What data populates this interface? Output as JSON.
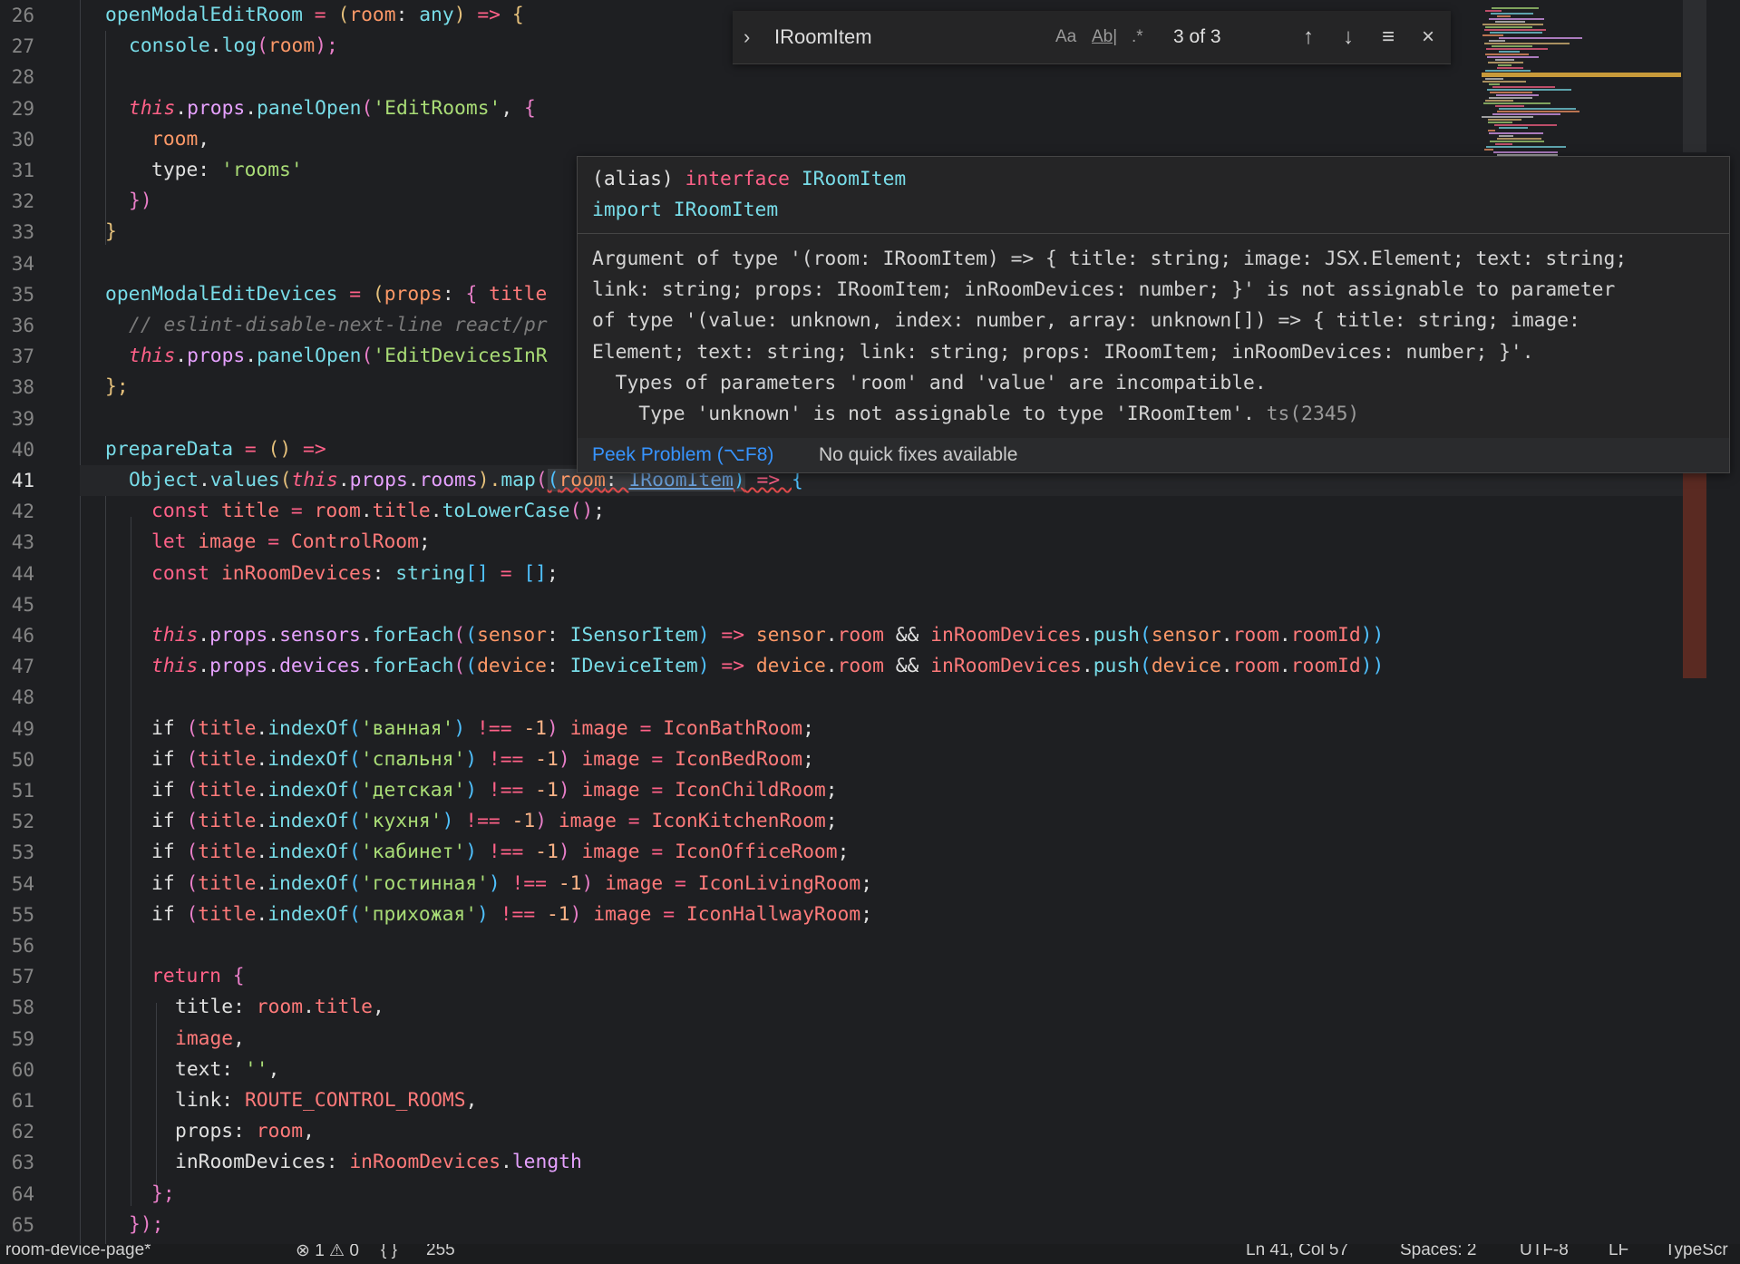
{
  "find_widget": {
    "query": "IRoomItem",
    "match_case_label": "Aa",
    "whole_word_label": "Ab|",
    "regex_label": ".*",
    "match_count": "3 of 3"
  },
  "hover": {
    "line1_alias": "(alias)",
    "line1_kw": "interface",
    "line1_name": "IRoomItem",
    "line2_kw": "import",
    "line2_name": "IRoomItem",
    "error_lines": [
      "Argument of type '(room: IRoomItem) => { title: string; image: JSX.Element; text: string;",
      "link: string; props: IRoomItem; inRoomDevices: number; }' is not assignable to parameter",
      "of type '(value: unknown, index: number, array: unknown[]) => { title: string; image:",
      "Element; text: string; link: string; props: IRoomItem; inRoomDevices: number; }'.",
      "  Types of parameters 'room' and 'value' are incompatible.",
      "    Type 'unknown' is not assignable to type 'IRoomItem'."
    ],
    "error_code": "ts(2345)",
    "peek_label": "Peek Problem (⌥F8)",
    "no_fix_label": "No quick fixes available"
  },
  "line_numbers": [
    "26",
    "27",
    "28",
    "29",
    "30",
    "31",
    "32",
    "33",
    "34",
    "35",
    "36",
    "37",
    "38",
    "39",
    "40",
    "41",
    "42",
    "43",
    "44",
    "45",
    "46",
    "47",
    "48",
    "49",
    "50",
    "51",
    "52",
    "53",
    "54",
    "55",
    "56",
    "57",
    "58",
    "59",
    "60",
    "61",
    "62",
    "63",
    "64",
    "65"
  ],
  "active_line": "41",
  "code": {
    "l26": [
      "openModalEditRoom",
      " = ",
      "(",
      "room",
      ": ",
      "any",
      ")",
      " => ",
      "{"
    ],
    "l27": [
      "console",
      ".",
      "log",
      "(",
      "room",
      ");"
    ],
    "l29": [
      "this",
      ".",
      "props",
      ".",
      "panelOpen",
      "(",
      "'EditRooms'",
      ", ",
      "{"
    ],
    "l30": [
      "room",
      ","
    ],
    "l31": [
      "type",
      ": ",
      "'rooms'"
    ],
    "l32": [
      "})"
    ],
    "l33": [
      "}"
    ],
    "l35": [
      "openModalEditDevices",
      " = ",
      "(",
      "props",
      ": ",
      "{ ",
      "title"
    ],
    "l36": [
      "// eslint-disable-next-line react/pr"
    ],
    "l37": [
      "this",
      ".",
      "props",
      ".",
      "panelOpen",
      "(",
      "'EditDevicesInR"
    ],
    "l38": [
      "};"
    ],
    "l40": [
      "prepareData",
      " = ",
      "()",
      " =>"
    ],
    "l41": [
      "Object",
      ".",
      "values",
      "(",
      "this",
      ".",
      "props",
      ".",
      "rooms",
      ").",
      "map",
      "(",
      "(",
      "room",
      ": ",
      "IRoomItem",
      ")",
      " => ",
      "{"
    ],
    "l42": [
      "const ",
      "title",
      " = ",
      "room",
      ".",
      "title",
      ".",
      "toLowerCase",
      "()",
      ";"
    ],
    "l43": [
      "let ",
      "image",
      " = ",
      "ControlRoom",
      ";"
    ],
    "l44": [
      "const ",
      "inRoomDevices",
      ": ",
      "string",
      "[]",
      " = ",
      "[]",
      ";"
    ],
    "l46": [
      "this",
      ".",
      "props",
      ".",
      "sensors",
      ".",
      "forEach",
      "(",
      "(",
      "sensor",
      ": ",
      "ISensorItem",
      ")",
      " => ",
      "sensor",
      ".",
      "room",
      " && ",
      "inRoomDevices",
      ".",
      "push",
      "(",
      "sensor",
      ".",
      "room",
      ".",
      "roomId",
      "))"
    ],
    "l47": [
      "this",
      ".",
      "props",
      ".",
      "devices",
      ".",
      "forEach",
      "(",
      "(",
      "device",
      ": ",
      "IDeviceItem",
      ")",
      " => ",
      "device",
      ".",
      "room",
      " && ",
      "inRoomDevices",
      ".",
      "push",
      "(",
      "device",
      ".",
      "room",
      ".",
      "roomId",
      "))"
    ],
    "conds": [
      {
        "str": "'ванная'",
        "icon": "IconBathRoom"
      },
      {
        "str": "'спальня'",
        "icon": "IconBedRoom"
      },
      {
        "str": "'детская'",
        "icon": "IconChildRoom"
      },
      {
        "str": "'кухня'",
        "icon": "IconKitchenRoom"
      },
      {
        "str": "'кабинет'",
        "icon": "IconOfficeRoom"
      },
      {
        "str": "'гостинная'",
        "icon": "IconLivingRoom"
      },
      {
        "str": "'прихожая'",
        "icon": "IconHallwayRoom"
      }
    ],
    "cond_parts": [
      "if ",
      "(",
      "title",
      ".",
      "indexOf",
      "(",
      ")",
      " !== ",
      "-1",
      ")",
      " image",
      " = ",
      ";"
    ],
    "l57": [
      "return ",
      "{"
    ],
    "l58": [
      "title",
      ": ",
      "room",
      ".",
      "title",
      ","
    ],
    "l59": [
      "image",
      ","
    ],
    "l60": [
      "text",
      ": ",
      "''",
      ","
    ],
    "l61": [
      "link",
      ": ",
      "ROUTE_CONTROL_ROOMS",
      ","
    ],
    "l62": [
      "props",
      ": ",
      "room",
      ","
    ],
    "l63": [
      "inRoomDevices",
      ": ",
      "inRoomDevices",
      ".",
      "length"
    ],
    "l64": [
      "};"
    ],
    "l65": [
      "});"
    ]
  },
  "statusbar": {
    "file": "room-device-page*",
    "errors": "⊗ 1 ⚠ 0",
    "braces": "{ }",
    "size": "255",
    "position": "Ln 41, Col 57",
    "spaces": "Spaces: 2",
    "encoding": "UTF-8",
    "eol": "LF",
    "language": "TypeScr"
  },
  "colors": {
    "background": "#1e1f22",
    "error_squiggle": "#e04a4a",
    "peek_link": "#3794ff"
  }
}
